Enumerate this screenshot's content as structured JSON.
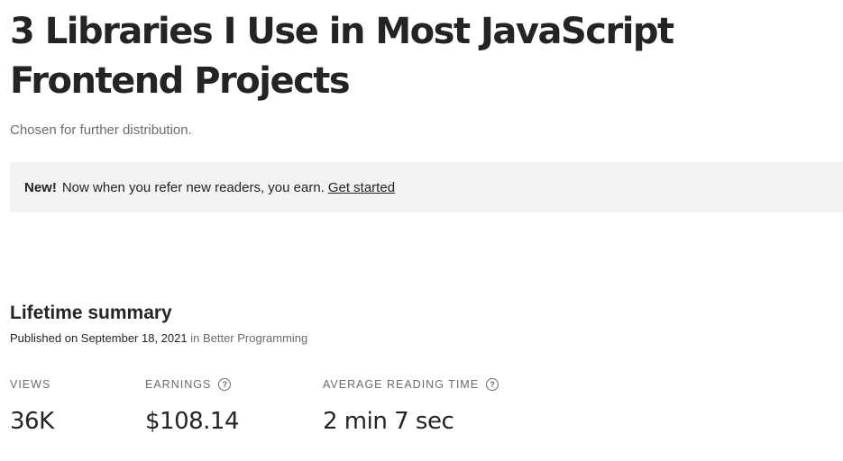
{
  "story": {
    "title": "3 Libraries I Use in Most JavaScript Frontend Projects",
    "subtitle": "Chosen for further distribution."
  },
  "banner": {
    "badge": "New!",
    "message": "Now when you refer new readers, you earn.",
    "link_label": "Get started"
  },
  "summary": {
    "heading": "Lifetime summary",
    "published_prefix": "Published on September 18, 2021",
    "published_in": "in Better Programming"
  },
  "stats": {
    "views": {
      "label": "VIEWS",
      "value": "36K"
    },
    "earnings": {
      "label": "EARNINGS",
      "value": "$108.14",
      "help_icon": "?"
    },
    "reading_time": {
      "label": "AVERAGE READING TIME",
      "value": "2 min 7 sec",
      "help_icon": "?"
    }
  },
  "icons": {
    "earnings_help": "question-circle-icon",
    "reading_help": "question-circle-icon"
  }
}
